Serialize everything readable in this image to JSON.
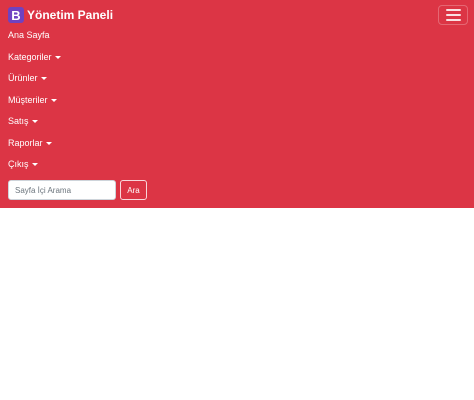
{
  "brand": {
    "logo_letter": "B",
    "title": "Yönetim Paneli"
  },
  "toggler": {
    "icon": "hamburger-menu-icon"
  },
  "nav": {
    "items": [
      {
        "label": "Ana Sayfa",
        "dropdown": false
      },
      {
        "label": "Kategoriler",
        "dropdown": true
      },
      {
        "label": "Ürünler",
        "dropdown": true
      },
      {
        "label": "Müşteriler",
        "dropdown": true
      },
      {
        "label": "Satış",
        "dropdown": true
      },
      {
        "label": "Raporlar",
        "dropdown": true
      },
      {
        "label": "Çıkış",
        "dropdown": true
      }
    ]
  },
  "search": {
    "placeholder": "Sayfa İçi Arama",
    "value": "",
    "button_label": "Ara"
  },
  "colors": {
    "navbar": "#dc3545",
    "brand_logo": "#6f42c1",
    "text": "#ffffff"
  }
}
